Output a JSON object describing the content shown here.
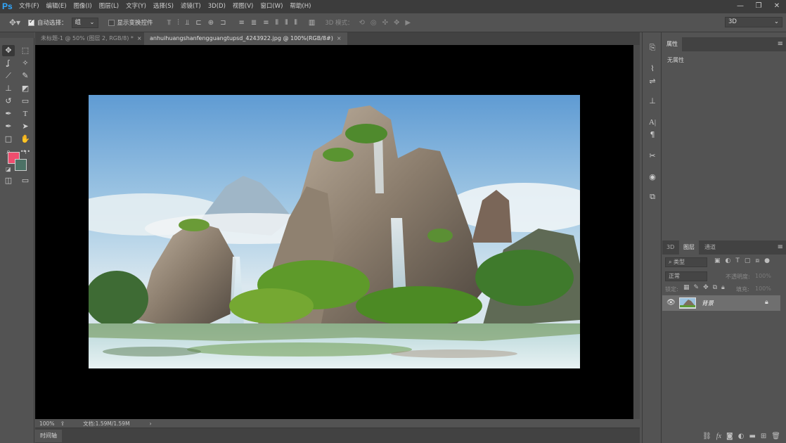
{
  "app": {
    "logo": "Ps"
  },
  "menu": [
    "文件(F)",
    "编辑(E)",
    "图像(I)",
    "图层(L)",
    "文字(Y)",
    "选择(S)",
    "滤镜(T)",
    "3D(D)",
    "视图(V)",
    "窗口(W)",
    "帮助(H)"
  ],
  "window_controls": {
    "minimize": "—",
    "restore": "❐",
    "close": "✕"
  },
  "options": {
    "auto_select_label": "自动选择：",
    "auto_select_value": "组",
    "show_transform_label": "显示变换控件",
    "mode_3d_label": "3D 模式：",
    "workspace_value": "3D"
  },
  "tabs": [
    {
      "label": "未标题-1 @ 50% (图层 2, RGB/8) *",
      "close": "×"
    },
    {
      "label": "anhuihuangshanfengguangtupsd_4243922.jpg @ 100%(RGB/8#)",
      "close": "×"
    }
  ],
  "status": {
    "zoom": "100%",
    "doc_info": "文档:1.59M/1.59M",
    "arrow": "›"
  },
  "timeline": {
    "label": "时间轴"
  },
  "properties": {
    "tab": "属性",
    "no_properties": "无属性"
  },
  "layers_panel": {
    "tabs": [
      "3D",
      "图层",
      "通道"
    ],
    "filter_placeholder": "类型",
    "blend_mode": "正常",
    "opacity_label": "不透明度:",
    "opacity_value": "100%",
    "lock_label": "锁定:",
    "fill_label": "填充:",
    "fill_value": "100%",
    "layer_name": "背景"
  },
  "icons": {
    "move": "✥",
    "marquee": "⬚",
    "lasso": "ʆ",
    "magic_wand": "✧",
    "eyedropper": "⟋",
    "brush": "✎",
    "stamp": "⊥",
    "eraser": "◩",
    "history_brush": "↺",
    "gradient": "▭",
    "pen": "✒",
    "type": "T",
    "path_select": "➤",
    "rectangle": "□",
    "hand": "✋",
    "zoom": "⌕",
    "more": "•••",
    "quick_mask": "◫",
    "screen_mode": "▭"
  },
  "colors": {
    "foreground": "#ee4d6e",
    "background": "#4c7165",
    "accent": "#31a8ff"
  }
}
